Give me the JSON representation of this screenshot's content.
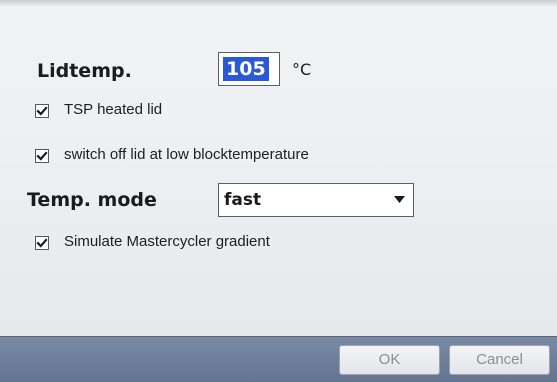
{
  "settings": {
    "lidtemp_label": "Lidtemp.",
    "lidtemp_value": "105",
    "lidtemp_unit": "°C",
    "tsp_heated_lid": {
      "label": "TSP heated lid",
      "checked": true
    },
    "switch_off_lid": {
      "label": "switch off lid at low blocktemperature",
      "checked": true
    },
    "temp_mode_label": "Temp. mode",
    "temp_mode_value": "fast",
    "simulate_gradient": {
      "label": "Simulate Mastercycler gradient",
      "checked": true
    }
  },
  "footer": {
    "ok_label": "OK",
    "cancel_label": "Cancel"
  },
  "icons": {
    "checkmark": "check-icon",
    "dropdown": "chevron-down-icon"
  }
}
